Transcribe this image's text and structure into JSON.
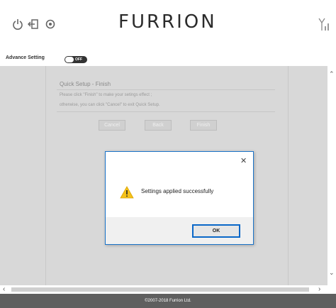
{
  "header": {
    "brand": "FURRION",
    "icons": [
      "power-icon",
      "logout-icon",
      "refresh-icon",
      "signal-icon"
    ]
  },
  "advance_setting": {
    "label": "Advance Setting",
    "toggle_state": "OFF"
  },
  "quick_setup": {
    "title": "Quick Setup - Finish",
    "line1": "Please click \"Finish\" to make your setings effect ;",
    "line2": "otherwise, you can click \"Cancel\" to exit Quick Setup.",
    "cancel_label": "Cancel",
    "back_label": "Back",
    "finish_label": "Finish"
  },
  "dialog": {
    "close_glyph": "✕",
    "message": "Settings applied successfully",
    "ok_label": "OK"
  },
  "footer": {
    "copyright": "©2007-2018 Furrion Ltd."
  },
  "colors": {
    "footer_bg": "#5f5f5f",
    "content_bg": "#d8d8d8",
    "dialog_border": "#1a73c8",
    "warning": "#f6c21a"
  }
}
